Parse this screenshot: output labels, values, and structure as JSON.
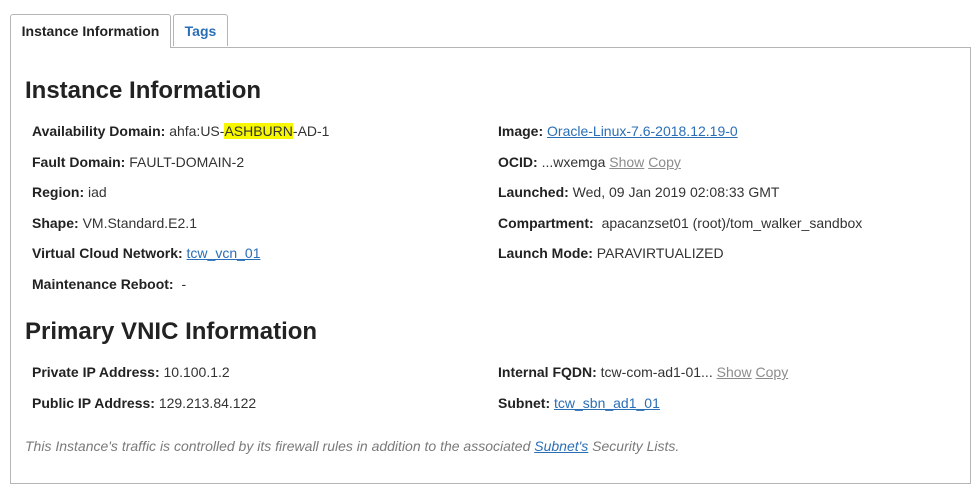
{
  "tabs": [
    {
      "label": "Instance Information",
      "active": true
    },
    {
      "label": "Tags",
      "active": false
    }
  ],
  "instance_info": {
    "title": "Instance Information",
    "availability_domain": {
      "label": "Availability Domain:",
      "prefix": "ahfa:US-",
      "highlight": "ASHBURN",
      "suffix": "-AD-1"
    },
    "fault_domain": {
      "label": "Fault Domain:",
      "value": "FAULT-DOMAIN-2"
    },
    "region": {
      "label": "Region:",
      "value": "iad"
    },
    "shape": {
      "label": "Shape:",
      "value": "VM.Standard.E2.1"
    },
    "vcn": {
      "label": "Virtual Cloud Network:",
      "value": "tcw_vcn_01"
    },
    "maintenance_reboot": {
      "label": "Maintenance Reboot:",
      "value": "-"
    },
    "image": {
      "label": "Image:",
      "value": "Oracle-Linux-7.6-2018.12.19-0"
    },
    "ocid": {
      "label": "OCID:",
      "value": "...wxemga",
      "show": "Show",
      "copy": "Copy"
    },
    "launched": {
      "label": "Launched:",
      "value": "Wed, 09 Jan 2019 02:08:33 GMT"
    },
    "compartment": {
      "label": "Compartment:",
      "value": "apacanzset01 (root)/tom_walker_sandbox"
    },
    "launch_mode": {
      "label": "Launch Mode:",
      "value": "PARAVIRTUALIZED"
    }
  },
  "vnic_info": {
    "title": "Primary VNIC Information",
    "private_ip": {
      "label": "Private IP Address:",
      "value": "10.100.1.2"
    },
    "public_ip": {
      "label": "Public IP Address:",
      "value": "129.213.84.122"
    },
    "fqdn": {
      "label": "Internal FQDN:",
      "value": "tcw-com-ad1-01...",
      "show": "Show",
      "copy": "Copy"
    },
    "subnet": {
      "label": "Subnet:",
      "value": "tcw_sbn_ad1_01"
    }
  },
  "footnote": {
    "before": "This Instance's traffic is controlled by its firewall rules in addition to the associated ",
    "link": "Subnet's",
    "after": " Security Lists."
  },
  "colors": {
    "link": "#2a6fb6",
    "highlight": "#f7f700",
    "muted": "#8c8c8c"
  }
}
